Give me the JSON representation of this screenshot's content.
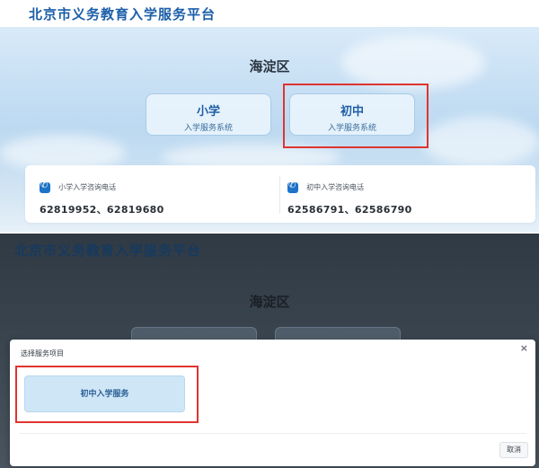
{
  "site": {
    "title": "北京市义务教育入学服务平台"
  },
  "top": {
    "district": "海淀区",
    "cards": [
      {
        "name": "小学",
        "subtitle": "入学服务系统"
      },
      {
        "name": "初中",
        "subtitle": "入学服务系统"
      }
    ],
    "phones": [
      {
        "label": "小学入学咨询电话",
        "numbers": "62819952、62819680"
      },
      {
        "label": "初中入学咨询电话",
        "numbers": "62586791、62586790"
      }
    ]
  },
  "bottom": {
    "district": "海淀区",
    "modal": {
      "title": "选择服务项目",
      "close": "×",
      "service_button": "初中入学服务",
      "cancel_button": "取消"
    }
  },
  "colors": {
    "brand_blue": "#1b5ea8",
    "highlight_red": "#e0342f",
    "service_button_bg": "#cfe6f7"
  }
}
